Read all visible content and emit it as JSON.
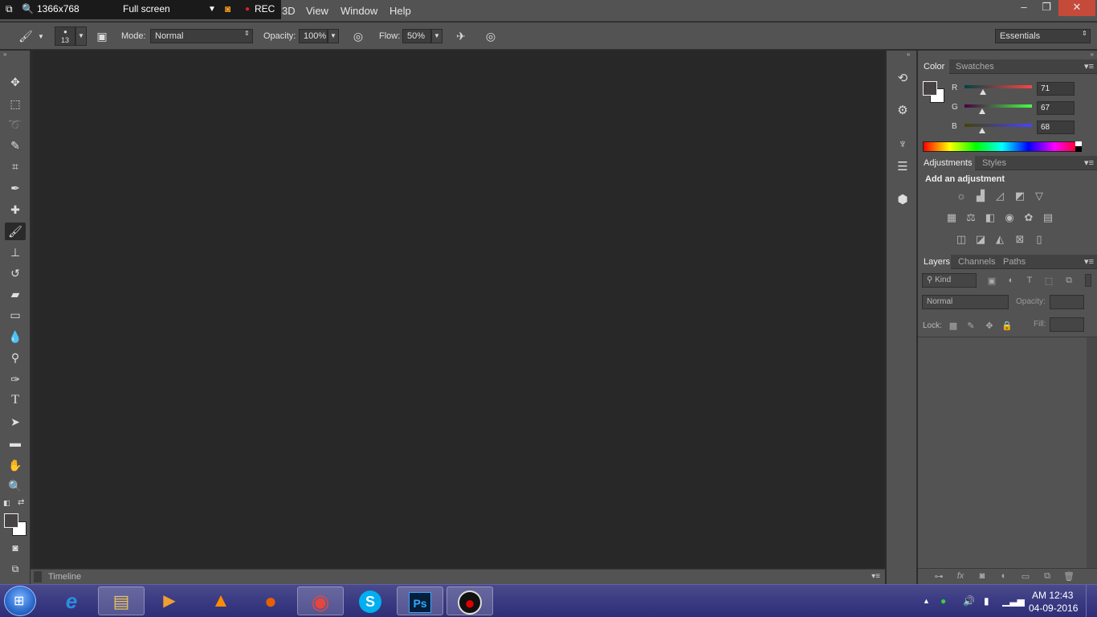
{
  "recorder": {
    "resolution": "1366x768",
    "mode": "Full screen",
    "rec_label": "REC"
  },
  "menu": {
    "items": [
      "3D",
      "View",
      "Window",
      "Help"
    ]
  },
  "window_controls": {
    "minimize": "–",
    "restore": "❐",
    "close": "✕"
  },
  "options_bar": {
    "brush_size": "13",
    "mode_label": "Mode:",
    "mode_value": "Normal",
    "opacity_label": "Opacity:",
    "opacity_value": "100%",
    "flow_label": "Flow:",
    "flow_value": "50%",
    "workspace": "Essentials"
  },
  "timeline": {
    "label": "Timeline"
  },
  "color_panel": {
    "tabs": [
      "Color",
      "Swatches"
    ],
    "r_label": "R",
    "r_value": "71",
    "g_label": "G",
    "g_value": "67",
    "b_label": "B",
    "b_value": "68",
    "foreground": "#474344",
    "background": "#ffffff"
  },
  "adjustments_panel": {
    "tabs": [
      "Adjustments",
      "Styles"
    ],
    "heading": "Add an adjustment"
  },
  "layers_panel": {
    "tabs": [
      "Layers",
      "Channels",
      "Paths"
    ],
    "kind_label": "Kind",
    "blend_mode": "Normal",
    "opacity_label": "Opacity:",
    "lock_label": "Lock:",
    "fill_label": "Fill:"
  },
  "taskbar": {
    "apps": [
      {
        "name": "internet-explorer",
        "glyph": "e",
        "color": "#2a8fe0"
      },
      {
        "name": "file-explorer",
        "glyph": "▤",
        "color": "#e8c35a"
      },
      {
        "name": "media-player",
        "glyph": "▶",
        "color": "#f0a030"
      },
      {
        "name": "vlc",
        "glyph": "▲",
        "color": "#ff8c00"
      },
      {
        "name": "firefox",
        "glyph": "●",
        "color": "#e66000"
      },
      {
        "name": "chrome",
        "glyph": "◉",
        "color": "#e8453c"
      },
      {
        "name": "skype",
        "glyph": "S",
        "color": "#00aff0"
      },
      {
        "name": "photoshop",
        "glyph": "Ps",
        "color": "#31a8ff"
      },
      {
        "name": "screen-recorder",
        "glyph": "●",
        "color": "#e00000"
      }
    ],
    "clock_time": "AM 12:43",
    "clock_date": "04-09-2016"
  }
}
